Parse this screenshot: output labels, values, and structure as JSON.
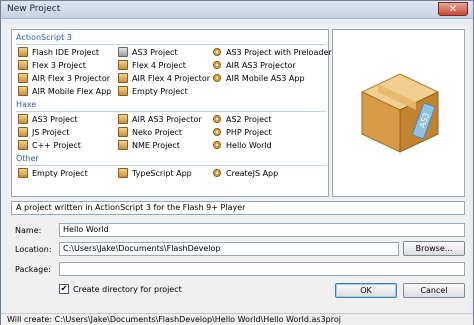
{
  "window": {
    "title": "New Project",
    "close_glyph": "✕"
  },
  "groups": {
    "actionscript3": {
      "header": "ActionScript 3",
      "items": [
        {
          "label": "Flash IDE Project",
          "icon": "box-icon"
        },
        {
          "label": "AS3 Project",
          "icon": "box-gray-icon"
        },
        {
          "label": "AS3 Project with Preloader",
          "icon": "gear-icon"
        },
        {
          "label": "Flex 3 Project",
          "icon": "box-icon"
        },
        {
          "label": "Flex 4 Project",
          "icon": "box-icon"
        },
        {
          "label": "AIR AS3 Projector",
          "icon": "gear-icon"
        },
        {
          "label": "AIR Flex 3 Projector",
          "icon": "box-icon"
        },
        {
          "label": "AIR Flex 4 Projector",
          "icon": "box-icon"
        },
        {
          "label": "AIR Mobile AS3 App",
          "icon": "gear-icon"
        },
        {
          "label": "AIR Mobile Flex App",
          "icon": "box-icon"
        },
        {
          "label": "Empty Project",
          "icon": "box-icon"
        }
      ]
    },
    "haxe": {
      "header": "Haxe",
      "items": [
        {
          "label": "AS3 Project",
          "icon": "box-icon"
        },
        {
          "label": "AIR AS3 Projector",
          "icon": "box-icon"
        },
        {
          "label": "AS2 Project",
          "icon": "gear-icon"
        },
        {
          "label": "JS Project",
          "icon": "box-icon"
        },
        {
          "label": "Neko Project",
          "icon": "box-icon"
        },
        {
          "label": "PHP Project",
          "icon": "gear-icon"
        },
        {
          "label": "C++ Project",
          "icon": "box-icon"
        },
        {
          "label": "NME Project",
          "icon": "box-icon"
        },
        {
          "label": "Hello World",
          "icon": "gear-icon"
        }
      ]
    },
    "other": {
      "header": "Other",
      "items": [
        {
          "label": "Empty Project",
          "icon": "box-icon"
        },
        {
          "label": "TypeScript App",
          "icon": "box-icon"
        },
        {
          "label": "CreateJS App",
          "icon": "gear-icon"
        }
      ]
    }
  },
  "preview": {
    "badge_text": "AS3"
  },
  "description": "A project written in ActionScript 3 for the Flash 9+ Player",
  "form": {
    "name_label": "Name:",
    "name_value": "Hello World",
    "location_label": "Location:",
    "location_value": "C:\\Users\\Jake\\Documents\\FlashDevelop",
    "package_label": "Package:",
    "package_value": "",
    "browse_label": "Browse...",
    "create_dir_label": "Create directory for project",
    "create_dir_checked": true,
    "ok_label": "OK",
    "cancel_label": "Cancel"
  },
  "status": "Will create: C:\\Users\\Jake\\Documents\\FlashDevelop\\Hello World\\Hello World.as3proj"
}
